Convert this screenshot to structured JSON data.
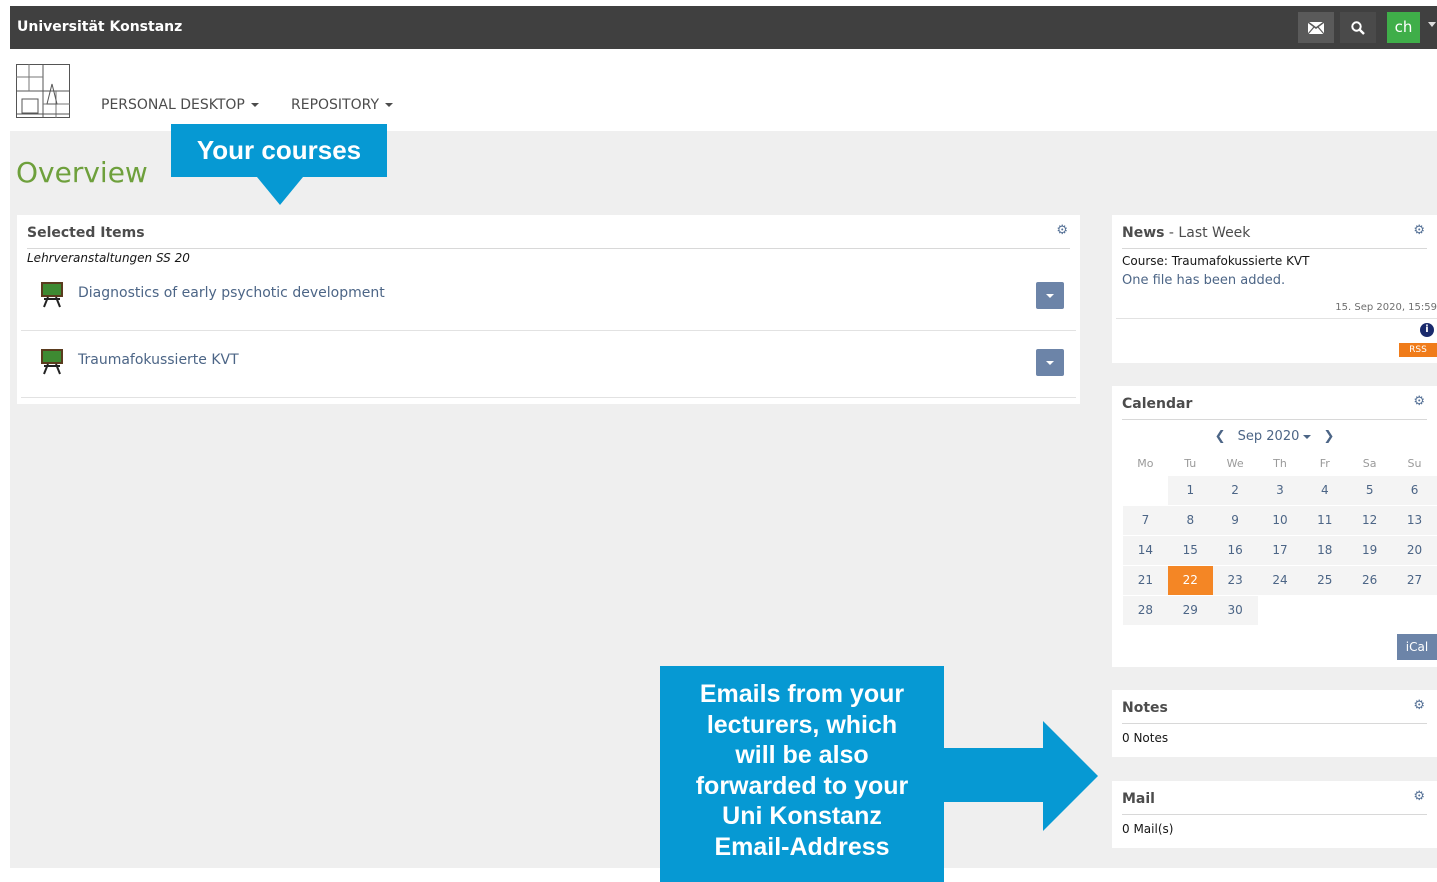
{
  "topbar": {
    "brand": "Universität Konstanz",
    "mail_icon": "envelope-icon",
    "search_icon": "search-icon",
    "user_initials": "ch"
  },
  "mainmenu": {
    "personal_desktop": "PERSONAL DESKTOP",
    "repository": "REPOSITORY"
  },
  "page": {
    "title": "Overview"
  },
  "selected_items": {
    "title": "Selected Items",
    "subtitle": "Lehrveranstaltungen SS 20",
    "courses": [
      {
        "name": "Diagnostics of early psychotic development",
        "icon": "course-icon"
      },
      {
        "name": "Traumafokussierte KVT",
        "icon": "course-icon"
      }
    ]
  },
  "news": {
    "title_bold": "News",
    "title_rest": " - Last Week",
    "course": "Course: Traumafokussierte KVT",
    "message": "One file has been added.",
    "date": "15. Sep 2020, 15:59",
    "info_symbol": "i",
    "rss": "RSS"
  },
  "calendar": {
    "title": "Calendar",
    "month_label": "Sep 2020",
    "prev_symbol": "❮",
    "next_symbol": "❯",
    "weekdays": [
      "Mo",
      "Tu",
      "We",
      "Th",
      "Fr",
      "Sa",
      "Su"
    ],
    "weeks": [
      [
        "",
        "1",
        "2",
        "3",
        "4",
        "5",
        "6"
      ],
      [
        "7",
        "8",
        "9",
        "10",
        "11",
        "12",
        "13"
      ],
      [
        "14",
        "15",
        "16",
        "17",
        "18",
        "19",
        "20"
      ],
      [
        "21",
        "22",
        "23",
        "24",
        "25",
        "26",
        "27"
      ],
      [
        "28",
        "29",
        "30",
        "",
        "",
        "",
        ""
      ]
    ],
    "today": "22",
    "ical": "iCal"
  },
  "notes": {
    "title": "Notes",
    "body": "0 Notes"
  },
  "mail": {
    "title": "Mail",
    "body": "0 Mail(s)"
  },
  "callouts": {
    "courses": "Your courses",
    "mail_lines": [
      "Emails from your",
      "lecturers, which",
      "will be also",
      "forwarded to your",
      "Uni Konstanz",
      "Email-Address"
    ]
  },
  "colors": {
    "accent_green": "#6ea03c",
    "callout_blue": "#0699d3",
    "today_orange": "#f48625",
    "button_blue": "#6c84a8"
  }
}
